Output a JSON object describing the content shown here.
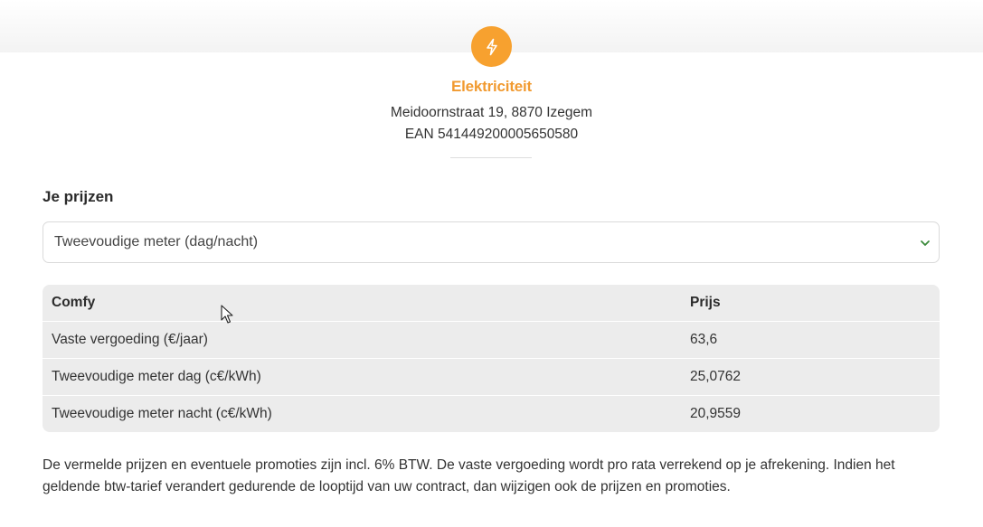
{
  "energy": {
    "title": "Elektriciteit",
    "icon": "lightning-bolt-icon",
    "address": "Meidoornstraat 19, 8870 Izegem",
    "ean": "EAN 541449200005650580",
    "accent_color": "#f7a12f"
  },
  "prices": {
    "heading": "Je prijzen",
    "meter_select": {
      "selected": "Tweevoudige meter (dag/nacht)",
      "chevron_color": "#3a8a3a"
    },
    "table": {
      "headers": [
        "Comfy",
        "Prijs"
      ],
      "rows": [
        {
          "name": "Vaste vergoeding (€/jaar)",
          "price": "63,6"
        },
        {
          "name": "Tweevoudige meter dag (c€/kWh)",
          "price": "25,0762"
        },
        {
          "name": "Tweevoudige meter nacht (c€/kWh)",
          "price": "20,9559"
        }
      ]
    },
    "disclaimer": "De vermelde prijzen en eventuele promoties zijn incl. 6% BTW. De vaste vergoeding wordt pro rata verrekend op je afrekening. Indien het geldende btw-tarief verandert gedurende de looptijd van uw contract, dan wijzigen ook de prijzen en promoties."
  }
}
